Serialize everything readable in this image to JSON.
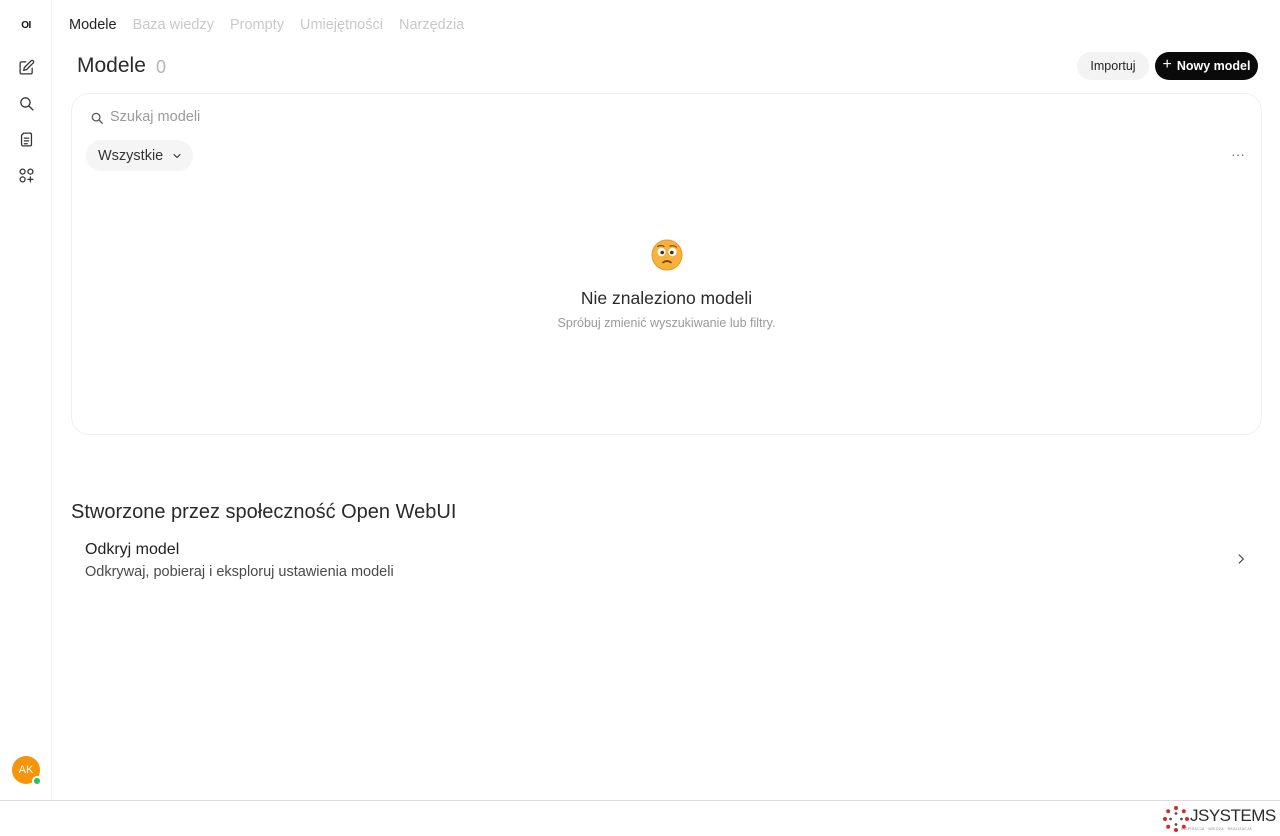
{
  "sidebar": {
    "logo": "OI",
    "avatar_initials": "AK",
    "icons": [
      "new-chat-icon",
      "search-icon",
      "notes-icon",
      "workspace-icon"
    ]
  },
  "tabs": [
    {
      "label": "Modele",
      "active": true
    },
    {
      "label": "Baza wiedzy",
      "active": false
    },
    {
      "label": "Prompty",
      "active": false
    },
    {
      "label": "Umiejętności",
      "active": false
    },
    {
      "label": "Narzędzia",
      "active": false
    }
  ],
  "header": {
    "title": "Modele",
    "count": "0",
    "import_label": "Importuj",
    "new_label": "Nowy model"
  },
  "search": {
    "placeholder": "Szukaj modeli",
    "value": ""
  },
  "filter": {
    "selected": "Wszystkie"
  },
  "more_label": "···",
  "empty_state": {
    "icon": "confused-face-emoji",
    "title": "Nie znaleziono modeli",
    "subtitle": "Spróbuj zmienić wyszukiwanie lub filtry."
  },
  "community": {
    "title": "Stworzone przez społeczność Open WebUI",
    "discover_title": "Odkryj model",
    "discover_subtitle": "Odkrywaj, pobieraj i eksploruj ustawienia modeli"
  },
  "footer": {
    "brand": "JSYSTEMS",
    "tagline": "INSPIRACJA · WIEDZA · REALIZACJA"
  },
  "colors": {
    "accent_dark": "#0a0a0a",
    "avatar": "#f4950c",
    "status_online": "#22c55e",
    "brand_red": "#d22b2b"
  }
}
